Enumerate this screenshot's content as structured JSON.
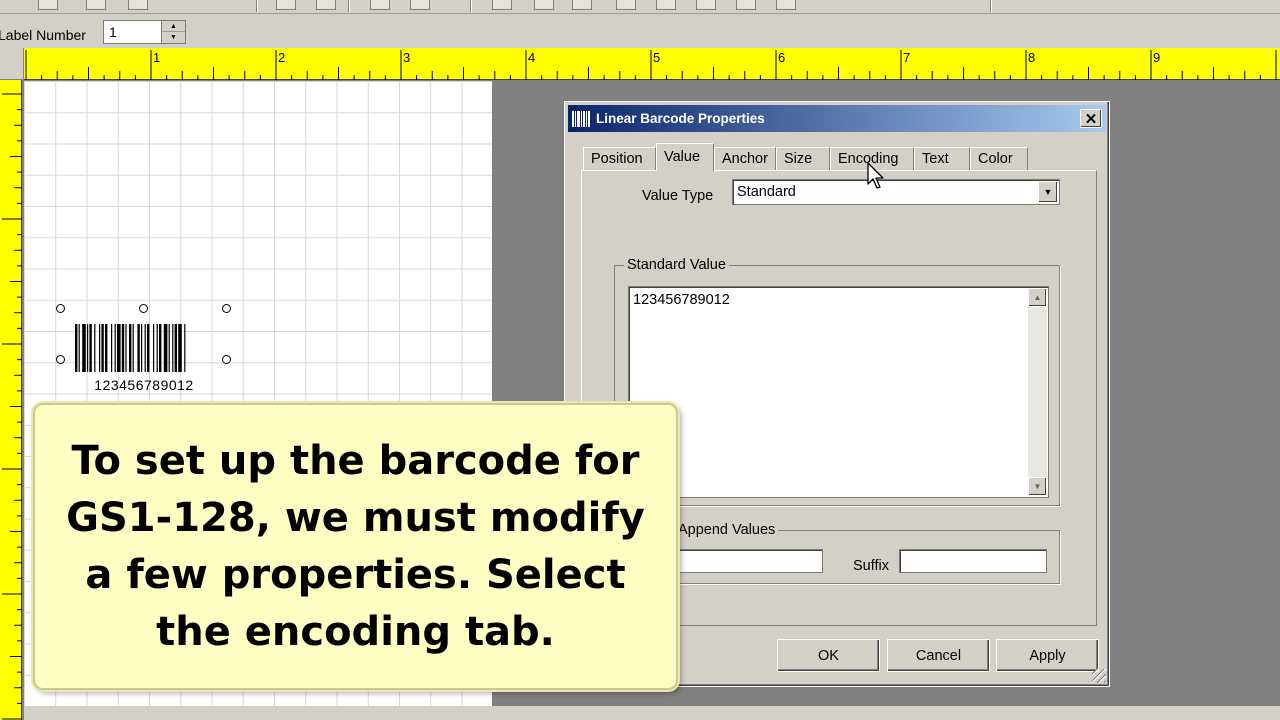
{
  "label_bar": {
    "label": "Label Number",
    "value": "1"
  },
  "ruler": {
    "numbers": [
      "1",
      "2",
      "3",
      "4",
      "5",
      "6",
      "7",
      "8",
      "9"
    ]
  },
  "barcode": {
    "text": "123456789012"
  },
  "dialog": {
    "title": "Linear Barcode Properties",
    "close_glyph": "✕",
    "tabs": [
      {
        "label": "Position"
      },
      {
        "label": "Value",
        "active": true
      },
      {
        "label": "Anchor"
      },
      {
        "label": "Size"
      },
      {
        "label": "Encoding"
      },
      {
        "label": "Text"
      },
      {
        "label": "Color"
      }
    ],
    "value_type": {
      "label": "Value Type",
      "selected": "Standard"
    },
    "standard_value": {
      "legend": "Standard Value",
      "value": "123456789012"
    },
    "append_values": {
      "legend": "Append Values",
      "prefix_value": "",
      "suffix_label": "Suffix",
      "suffix_value": ""
    },
    "buttons": {
      "ok": "OK",
      "cancel": "Cancel",
      "apply": "Apply"
    }
  },
  "caption": {
    "text": "To set up the barcode for GS1-128, we must modify a few properties. Select the encoding tab."
  },
  "icons": {
    "cursor": "mouse-pointer-icon",
    "dropdown": "chevron-down-icon",
    "scroll_up": "scroll-up-icon",
    "scroll_down": "scroll-down-icon"
  },
  "colors": {
    "ruler": "#ffff00",
    "title_bar": "#0a246a",
    "caption_bg": "#ffffc4",
    "workspace": "#808080"
  }
}
